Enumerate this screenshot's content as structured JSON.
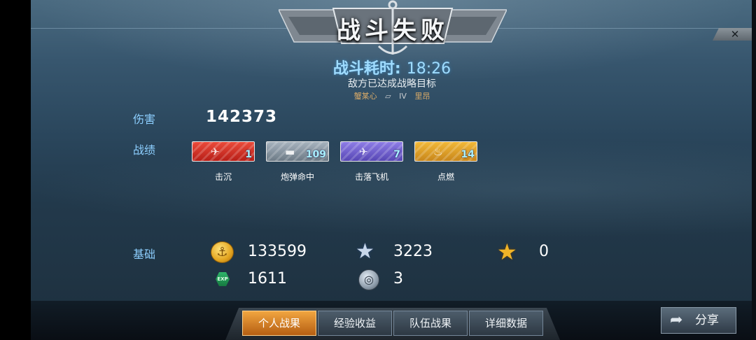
{
  "banner": {
    "title": "战斗失败"
  },
  "close": {
    "symbol": "✕"
  },
  "battle": {
    "time_label": "战斗耗时:",
    "time_value": "18:26",
    "reason": "敌方已达成战略目标",
    "player_name": "蟹某心",
    "player_rank": "IV",
    "ship_name": "里昂"
  },
  "damage": {
    "label": "伤害",
    "value": "142373"
  },
  "achievements": {
    "label": "战绩",
    "items": [
      {
        "name": "击沉",
        "count": "1",
        "color": "#d63a2c",
        "icon": "plane-icon"
      },
      {
        "name": "炮弹命中",
        "count": "109",
        "color": "#8795a2",
        "icon": "shell-icon"
      },
      {
        "name": "击落飞机",
        "count": "7",
        "color": "#6f5fd0",
        "icon": "planes-icon"
      },
      {
        "name": "点燃",
        "count": "14",
        "color": "#e2a02c",
        "icon": "fire-icon"
      }
    ]
  },
  "base": {
    "label": "基础",
    "gold": "133599",
    "silver_star": "3223",
    "gold_star": "0",
    "exp": "1611",
    "exp_badge": "EXP",
    "silver_coin": "3"
  },
  "tabs": [
    "个人战果",
    "经验收益",
    "队伍战果",
    "详细数据"
  ],
  "active_tab": 0,
  "share": {
    "label": "分享"
  }
}
